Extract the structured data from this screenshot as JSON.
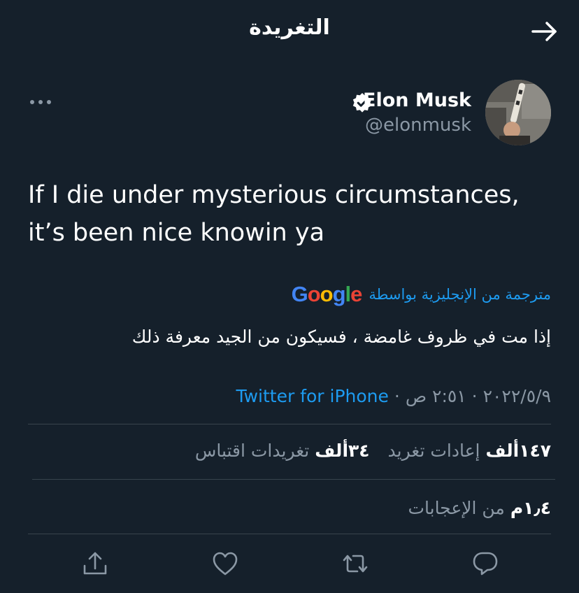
{
  "header": {
    "title": "التغريدة",
    "back_icon": "arrow-right-icon"
  },
  "author": {
    "name": "Elon Musk",
    "handle": "@elonmusk",
    "verified_icon": "verified-badge-icon",
    "more_icon": "more-dots-icon"
  },
  "tweet": {
    "text_line1": "If I die under mysterious circumstances,",
    "text_line2": "it’s been nice knowin ya",
    "translated_label": "مترجمة من الإنجليزية بواسطة",
    "translator": "Google",
    "translation": "إذا مت في ظروف غامضة ، فسيكون من الجيد معرفة ذلك"
  },
  "meta": {
    "date": "٢٠٢٢/٥/٩ · ٢:٥١ ص",
    "separator": "·",
    "source": "Twitter for iPhone"
  },
  "stats": {
    "retweets_value": "١٤٧ألف",
    "retweets_label": "إعادات تغريد",
    "quotes_value": "٣٤ألف",
    "quotes_label": "تغريدات اقتباس",
    "likes_value": "١٫٤م",
    "likes_label": "من الإعجابات"
  },
  "actions": {
    "icons": [
      "share-icon",
      "like-heart-icon",
      "retweet-icon",
      "reply-icon"
    ]
  },
  "colors": {
    "background": "#15202b",
    "text": "#ffffff",
    "muted": "#8b98a5",
    "accent": "#1d9bf0",
    "divider": "#38444d"
  }
}
